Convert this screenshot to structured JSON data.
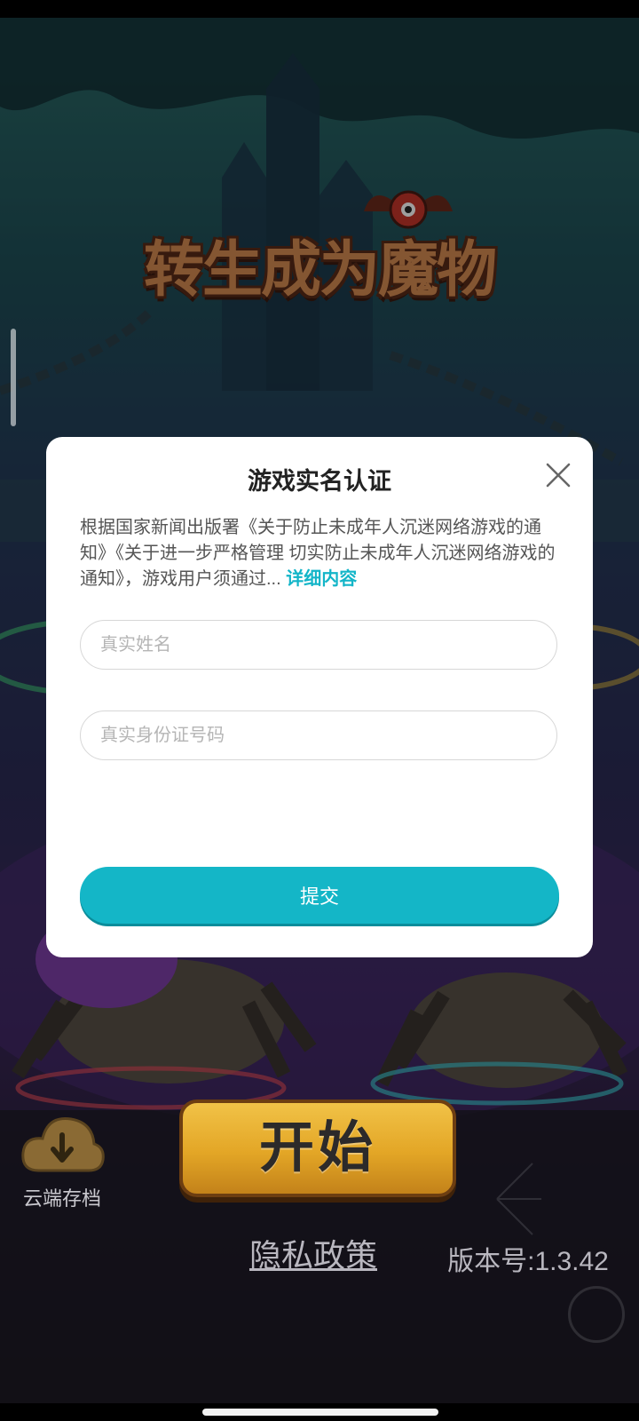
{
  "game": {
    "logo_text": "转生成为魔物",
    "cloud_save_label": "云端存档",
    "start_label": "开始",
    "privacy_label": "隐私政策",
    "version_text": "版本号:1.3.42"
  },
  "dialog": {
    "title": "游戏实名认证",
    "description": "根据国家新闻出版署《关于防止未成年人沉迷网络游戏的通知》《关于进一步严格管理 切实防止未成年人沉迷网络游戏的通知》，游戏用户须通过...",
    "detail_link": "详细内容",
    "name_placeholder": "真实姓名",
    "name_value": "",
    "id_placeholder": "真实身份证号码",
    "id_value": "",
    "submit_label": "提交"
  },
  "colors": {
    "accent": "#14b6c7",
    "start_button": "#e3a626"
  }
}
